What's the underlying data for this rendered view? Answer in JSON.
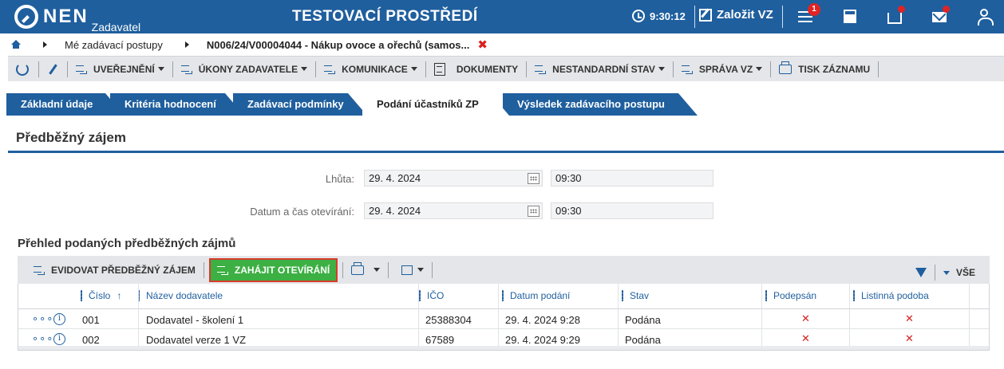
{
  "header": {
    "logo": "NEN",
    "logo_sub": "Zadavatel",
    "env_title": "TESTOVACÍ PROSTŘEDÍ",
    "time": "9:30:12",
    "create_label": "Založit VZ",
    "notif_count": "1"
  },
  "breadcrumb": {
    "item1": "Mé zadávací postupy",
    "item2": "N006/24/V00004044 - Nákup ovoce a ořechů (samos...",
    "close": "✖"
  },
  "toolbar": {
    "uverejneni": "UVEŘEJNĚNÍ",
    "ukony": "ÚKONY ZADAVATELE",
    "komunikace": "KOMUNIKACE",
    "dokumenty": "DOKUMENTY",
    "nestandardni": "NESTANDARDNÍ STAV",
    "sprava": "SPRÁVA VZ",
    "tisk": "TISK ZÁZNAMU"
  },
  "tabs": [
    "Základní údaje",
    "Kritéria hodnocení",
    "Zadávací podmínky",
    "Podání účastníků ZP",
    "Výsledek zadávacího postupu"
  ],
  "section": {
    "title": "Předběžný zájem"
  },
  "form": {
    "lhuta_label": "Lhůta:",
    "lhuta_date": "29. 4. 2024",
    "lhuta_time": "09:30",
    "otevreni_label": "Datum a čas otevírání:",
    "otevreni_date": "29. 4. 2024",
    "otevreni_time": "09:30"
  },
  "grid": {
    "title": "Přehled podaných předběžných zájmů",
    "btn_evidovat": "EVIDOVAT PŘEDBĚŽNÝ ZÁJEM",
    "btn_zahajit": "ZAHÁJIT OTEVÍRÁNÍ",
    "vse": "VŠE",
    "columns": [
      "Číslo",
      "Název dodavatele",
      "IČO",
      "Datum podání",
      "Stav",
      "Podepsán",
      "Listinná podoba"
    ],
    "sort_arrow": "↑",
    "rows": [
      {
        "cislo": "001",
        "nazev": "Dodavatel - školení 1",
        "ico": "25388304",
        "datum": "29. 4. 2024 9:28",
        "stav": "Podána",
        "podepsan": "✕",
        "listinna": "✕"
      },
      {
        "cislo": "002",
        "nazev": "Dodavatel verze 1 VZ",
        "ico": "67589",
        "datum": "29. 4. 2024 9:29",
        "stav": "Podána",
        "podepsan": "✕",
        "listinna": "✕"
      }
    ],
    "row_menu": "∘∘∘",
    "row_info": "i"
  },
  "colors": {
    "primary": "#1f5f9e",
    "green_button": "#3cb043",
    "highlight_border": "#d93a2b",
    "badge": "#e02424",
    "toolbar_bg": "#e4e6e9"
  }
}
